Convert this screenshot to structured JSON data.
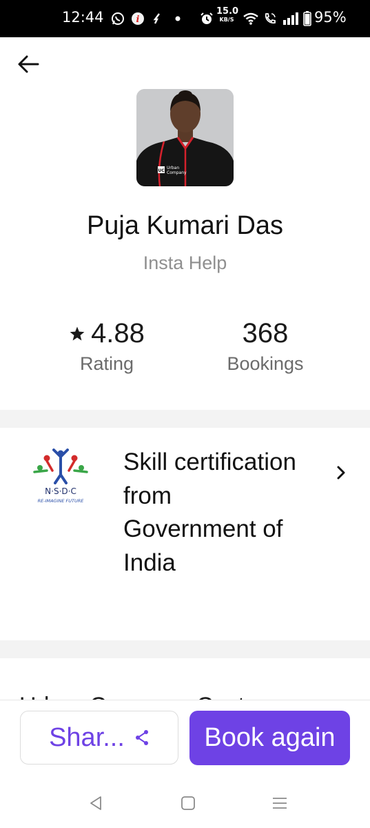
{
  "status_bar": {
    "time": "12:44",
    "net_speed_value": "15.0",
    "net_speed_unit": "KB/S",
    "battery": "95%",
    "icons": [
      "whatsapp-icon",
      "app-notification-icon",
      "app-notification-icon",
      "dot-icon",
      "alarm-icon",
      "wifi-icon",
      "call-icon",
      "signal-icon",
      "battery-icon"
    ]
  },
  "profile": {
    "name": "Puja Kumari Das",
    "role": "Insta Help",
    "avatar_badge_line1": "Urban",
    "avatar_badge_line2": "Company",
    "avatar_badge_logo": "UC"
  },
  "stats": {
    "rating_value": "4.88",
    "rating_label": "Rating",
    "bookings_value": "368",
    "bookings_label": "Bookings"
  },
  "certification": {
    "logo_text": "N·S·D·C",
    "logo_tagline": "RE-IMAGINE FUTURE",
    "text": "Skill certification from Government of India"
  },
  "partial_section_title": "Urban Company Custo",
  "actions": {
    "share_label": "Shar...",
    "book_again_label": "Book again"
  },
  "colors": {
    "accent": "#6e42e5",
    "secondary_text": "#8f8f8f",
    "separator": "#f3f3f3"
  }
}
